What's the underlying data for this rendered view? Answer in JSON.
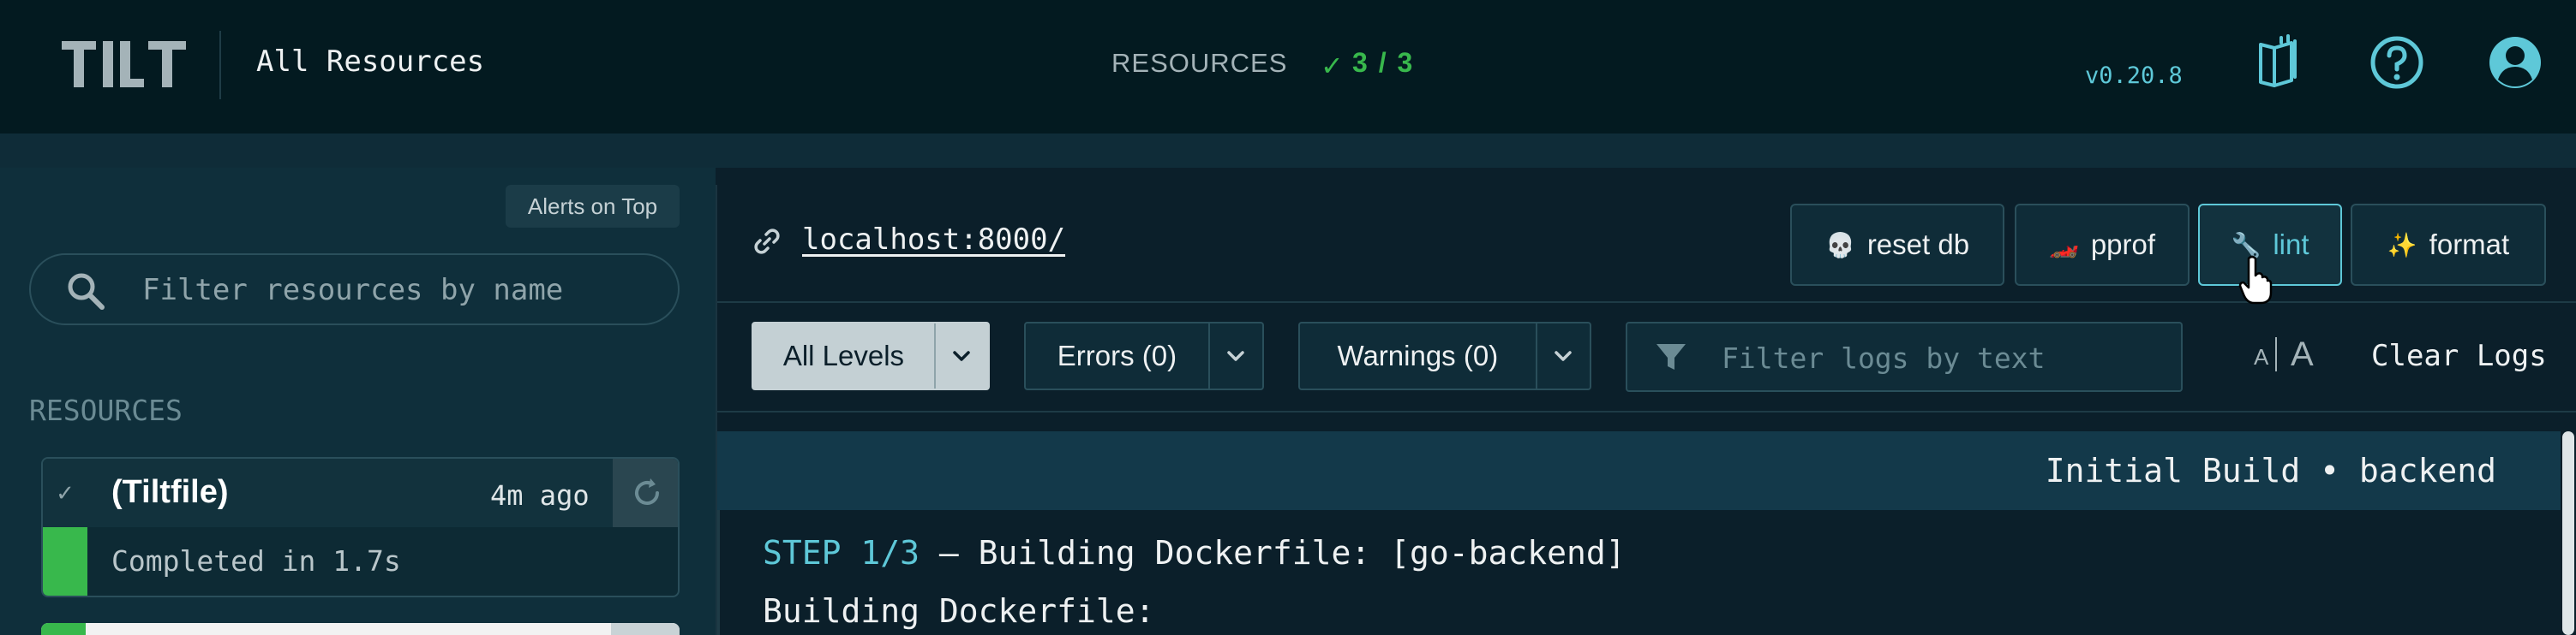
{
  "header": {
    "logo_text": "TILT",
    "page_name": "All Resources",
    "resources_label": "RESOURCES",
    "resources_check": "✓",
    "resources_count": "3 / 3",
    "version": "v0.20.8",
    "icons": [
      "docs-icon",
      "help-icon",
      "account-icon"
    ]
  },
  "sidebar": {
    "alerts_on_top_label": "Alerts on Top",
    "search_placeholder": "Filter resources by name",
    "section_title": "RESOURCES",
    "resources": [
      {
        "name": "(Tiltfile)",
        "time": "4m ago",
        "status_text": "Completed in 1.7s",
        "status": "success"
      }
    ]
  },
  "main": {
    "url": "localhost:8000/",
    "actions": [
      {
        "label": "reset db",
        "icon": "💀"
      },
      {
        "label": "pprof",
        "icon": "🏎️"
      },
      {
        "label": "lint",
        "icon": "🔧",
        "active": true
      },
      {
        "label": "format",
        "icon": "✨"
      }
    ],
    "levels": [
      {
        "label": "All Levels",
        "selected": true
      },
      {
        "label": "Errors (0)",
        "selected": false
      },
      {
        "label": "Warnings (0)",
        "selected": false
      }
    ],
    "log_filter_placeholder": "Filter logs by text",
    "font_small": "A",
    "font_large": "A",
    "clear_logs_label": "Clear Logs",
    "build_title": "Initial Build • backend",
    "log_lines": [
      {
        "step": "STEP 1/3",
        "text": " — Building Dockerfile: [go-backend]"
      },
      {
        "step": "",
        "text": "Building Dockerfile:"
      }
    ]
  },
  "colors": {
    "background": "#0b1f2a",
    "header": "#031a20",
    "accent": "#5ec8d8",
    "success": "#38b84c"
  }
}
